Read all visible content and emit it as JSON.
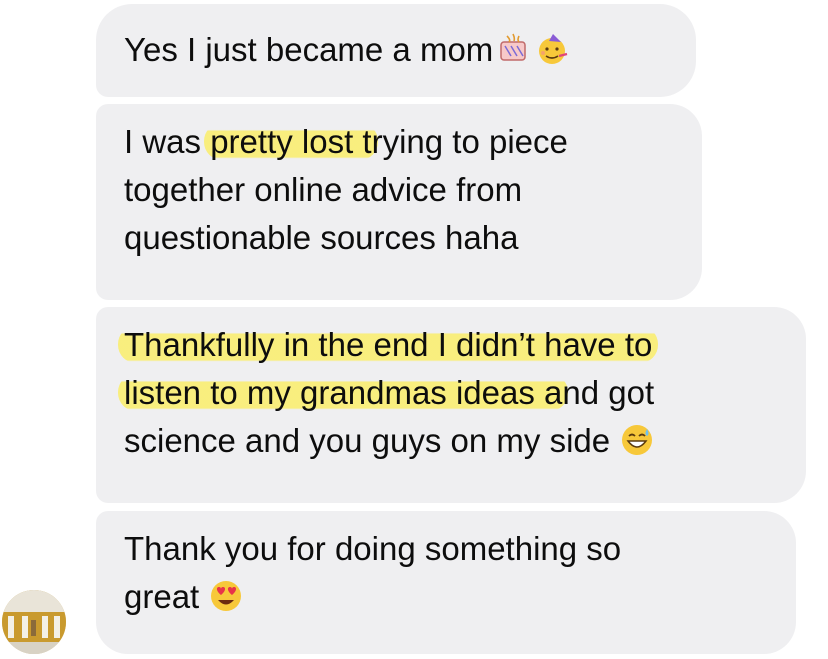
{
  "conversation": {
    "messages": [
      {
        "lines": [
          [
            {
              "text": "Yes I just became a mom"
            }
          ]
        ],
        "emoji": [
          "party-popper-icon",
          "partying-face-icon"
        ]
      },
      {
        "lines": [
          [
            {
              "text": "I was "
            },
            {
              "text": "pretty lost t",
              "highlight": true
            },
            {
              "text": "rying to piece"
            }
          ],
          [
            {
              "text": "together online advice from"
            }
          ],
          [
            {
              "text": "questionable sources haha"
            }
          ]
        ]
      },
      {
        "lines": [
          [
            {
              "text": "Thankfully in the end I didn’t have to",
              "highlight": true
            }
          ],
          [
            {
              "text": "listen to my grandmas ideas a",
              "highlight": true
            },
            {
              "text": "nd got"
            }
          ],
          [
            {
              "text": "science and you guys on my side"
            }
          ]
        ],
        "emoji": [
          "grinning-sweat-face-icon"
        ]
      },
      {
        "lines": [
          [
            {
              "text": "Thank you for doing something so"
            }
          ],
          [
            {
              "text": "great"
            }
          ]
        ],
        "emoji": [
          "heart-eyes-face-icon"
        ]
      }
    ],
    "highlight_color": "#f6eb68",
    "bubble_color": "#efeff1"
  },
  "sender": {
    "avatar_icon": "avatar"
  }
}
